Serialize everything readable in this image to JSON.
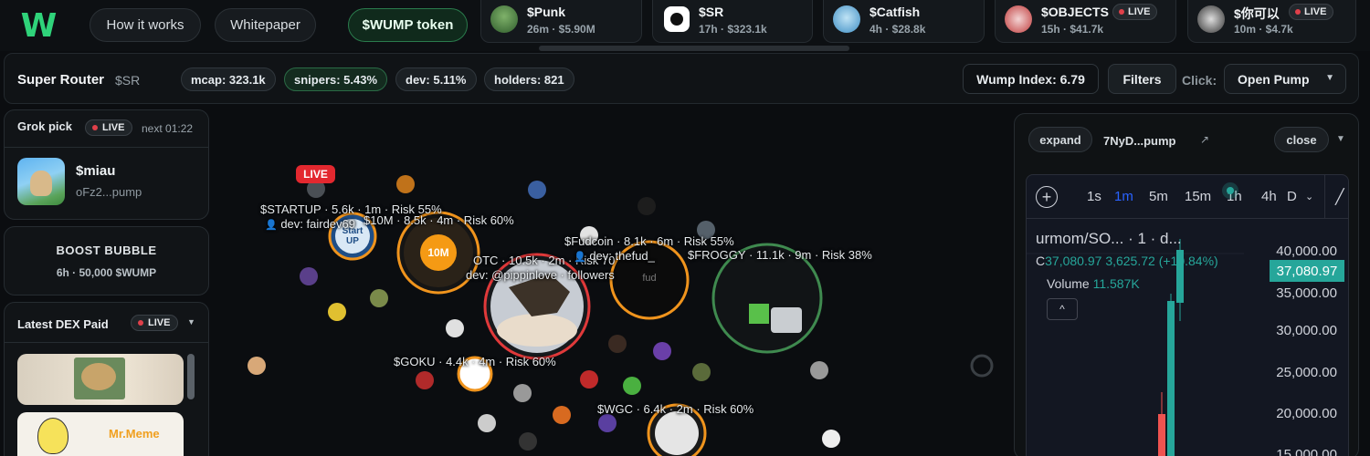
{
  "nav": {
    "logo": "W",
    "how_it_works": "How it works",
    "whitepaper": "Whitepaper",
    "token": "$WUMP token"
  },
  "tickers": [
    {
      "name": "$Punk",
      "meta": "26m · $5.90M",
      "live": ""
    },
    {
      "name": "$SR",
      "meta": "17h · $323.1k",
      "live": ""
    },
    {
      "name": "$Catfish",
      "meta": "4h · $28.8k",
      "live": ""
    },
    {
      "name": "$OBJECTS",
      "meta": "15h · $41.7k",
      "live": "LIVE"
    },
    {
      "name": "$你可以",
      "meta": "10m · $4.7k",
      "live": "LIVE"
    }
  ],
  "token_bar": {
    "title": "Super Router",
    "ticker": "$SR",
    "stats": {
      "mcap": "mcap: 323.1k",
      "snipers": "snipers: 5.43%",
      "dev": "dev: 5.11%",
      "holders": "holders: 821"
    },
    "wump_index": "Wump Index: 6.79",
    "filters": "Filters",
    "click_label": "Click:",
    "click_action": "Open Pump"
  },
  "grok": {
    "header": "Grok pick",
    "live": "LIVE",
    "next": "next 01:22",
    "pick_name": "$miau",
    "pick_address": "oFz2...pump"
  },
  "boost": {
    "title": "BOOST BUBBLE",
    "subtitle": "6h · 50,000 $WUMP"
  },
  "dex": {
    "header": "Latest DEX Paid",
    "live": "LIVE",
    "card2_text": "Mr.Meme"
  },
  "bubbles": {
    "live_badge": "LIVE",
    "labels": {
      "startup": "$STARTUP · 5.6k · 1m · Risk 55%",
      "startup_dev": "dev: fairdev69",
      "tenm": "$10M · 8.5k · 4m · Risk 60%",
      "tenm_center": "10M",
      "otc": "OTC · 10.5k · 2m · Risk 70",
      "otc_dev": "dev: @pippinlove · followers",
      "fudcoin": "$Fudcoin · 8.1k · 6m · Risk 55%",
      "fudcoin_dev": "dev: thefud_",
      "froggy": "$FROGGY · 11.1k · 9m · Risk 38%",
      "goku": "$GOKU · 4.4k · 4m · Risk 60%",
      "wgc": "$WGC · 6.4k · 2m · Risk 60%",
      "startup_text": "Start UP",
      "fudcoin_text": "fud"
    }
  },
  "chart_panel": {
    "expand": "expand",
    "address": "7NyD...pump",
    "ext_icon": "↗",
    "close": "close",
    "timeframes": [
      "1s",
      "1m",
      "5m",
      "15m",
      "1h",
      "4h",
      "D"
    ],
    "active_timeframe": "1m",
    "symbol": "urmom/SO... · 1 · d...",
    "ohlc_prefix": "C",
    "ohlc_close": "37,080.97",
    "ohlc_change": "3,625.72 (+10.84%)",
    "volume_label": "Volume",
    "volume_value": "11.587K",
    "price_axis": [
      "40,000.00",
      "35,000.00",
      "30,000.00",
      "25,000.00",
      "20,000.00",
      "15,000.00"
    ],
    "last_price": "37,080.97",
    "colors": {
      "up": "#26a69a",
      "down": "#ef5350",
      "accent": "#2962ff"
    }
  }
}
